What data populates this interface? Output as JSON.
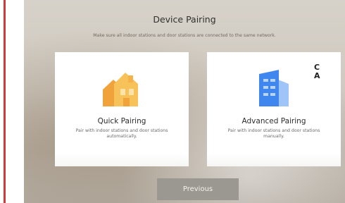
{
  "header": {
    "title": "Device Pairing",
    "subtitle": "Make sure all indoor stations and door stations are connected to the same network."
  },
  "cards": [
    {
      "title": "Quick Pairing",
      "description": "Pair with indoor stations and door stations automatically.",
      "icon": "house-icon",
      "color": "#f5b445"
    },
    {
      "title": "Advanced Pairing",
      "description": "Pair with indoor stations and door stations manually.",
      "icon": "building-icon",
      "color": "#4a8df0"
    }
  ],
  "footer": {
    "previous_label": "Previous"
  },
  "edge_text": {
    "line1": "C",
    "line2": "A"
  }
}
